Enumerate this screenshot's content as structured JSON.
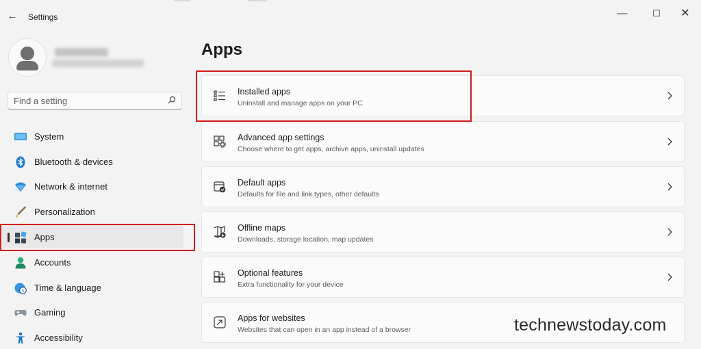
{
  "window": {
    "back_icon": "back-arrow-icon",
    "title": "Settings",
    "controls": [
      "minimize-icon",
      "maximize-icon",
      "close-icon"
    ]
  },
  "search": {
    "placeholder": "Find a setting",
    "icon": "search-icon"
  },
  "sidebar": {
    "items": [
      {
        "label": "System",
        "icon": "monitor-icon",
        "active": false
      },
      {
        "label": "Bluetooth & devices",
        "icon": "bluetooth-icon",
        "active": false
      },
      {
        "label": "Network & internet",
        "icon": "wifi-icon",
        "active": false
      },
      {
        "label": "Personalization",
        "icon": "brush-icon",
        "active": false
      },
      {
        "label": "Apps",
        "icon": "apps-icon",
        "active": true
      },
      {
        "label": "Accounts",
        "icon": "person-icon",
        "active": false
      },
      {
        "label": "Time & language",
        "icon": "globe-clock-icon",
        "active": false
      },
      {
        "label": "Gaming",
        "icon": "gamepad-icon",
        "active": false
      },
      {
        "label": "Accessibility",
        "icon": "accessibility-icon",
        "active": false
      }
    ]
  },
  "main": {
    "title": "Apps",
    "cards": [
      {
        "title": "Installed apps",
        "subtitle": "Uninstall and manage apps on your PC",
        "icon": "list-icon"
      },
      {
        "title": "Advanced app settings",
        "subtitle": "Choose where to get apps, archive apps, uninstall updates",
        "icon": "app-settings-icon"
      },
      {
        "title": "Default apps",
        "subtitle": "Defaults for file and link types, other defaults",
        "icon": "default-apps-icon"
      },
      {
        "title": "Offline maps",
        "subtitle": "Downloads, storage location, map updates",
        "icon": "map-download-icon"
      },
      {
        "title": "Optional features",
        "subtitle": "Extra functionality for your device",
        "icon": "add-grid-icon"
      },
      {
        "title": "Apps for websites",
        "subtitle": "Websites that can open in an app instead of a browser",
        "icon": "open-external-icon"
      }
    ]
  },
  "watermark": "technewstoday.com",
  "colors": {
    "highlight_red": "#d01c1c",
    "window_bg": "#f3f3f3",
    "card_bg": "#fbfbfb",
    "accent_blue": "#0067c0"
  }
}
